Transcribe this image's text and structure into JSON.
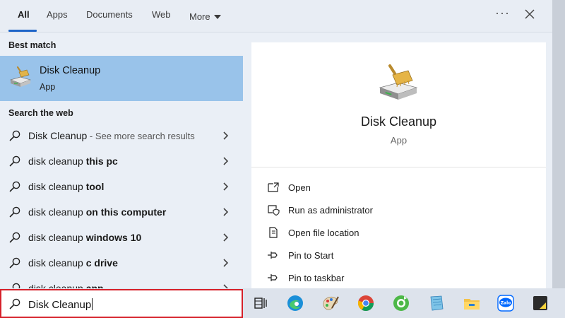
{
  "tabs": [
    {
      "label": "All",
      "active": true
    },
    {
      "label": "Apps"
    },
    {
      "label": "Documents"
    },
    {
      "label": "Web"
    },
    {
      "label": "More"
    }
  ],
  "top_icons": {
    "more_options": "more-options-icon",
    "close": "close-icon"
  },
  "left": {
    "best_match_title": "Best match",
    "best_match": {
      "name": "Disk Cleanup",
      "type": "App",
      "icon": "disk-cleanup-icon"
    },
    "web_section_title": "Search the web",
    "web_results": [
      {
        "prefix": "Disk Cleanup",
        "bold": "",
        "suffix": " - See more search results"
      },
      {
        "prefix": "disk cleanup ",
        "bold": "this pc",
        "suffix": ""
      },
      {
        "prefix": "disk cleanup ",
        "bold": "tool",
        "suffix": ""
      },
      {
        "prefix": "disk cleanup ",
        "bold": "on this computer",
        "suffix": ""
      },
      {
        "prefix": "disk cleanup ",
        "bold": "windows 10",
        "suffix": ""
      },
      {
        "prefix": "disk cleanup ",
        "bold": "c drive",
        "suffix": ""
      },
      {
        "prefix": "disk cleanup ",
        "bold": "app",
        "suffix": ""
      }
    ]
  },
  "right": {
    "app_name": "Disk Cleanup",
    "app_type": "App",
    "actions": [
      {
        "label": "Open",
        "icon": "open-icon"
      },
      {
        "label": "Run as administrator",
        "icon": "shield-icon"
      },
      {
        "label": "Open file location",
        "icon": "file-location-icon"
      },
      {
        "label": "Pin to Start",
        "icon": "pin-icon"
      },
      {
        "label": "Pin to taskbar",
        "icon": "pin-icon"
      }
    ]
  },
  "search": {
    "value": "Disk Cleanup"
  },
  "taskbar_icons": [
    "task-view-icon",
    "edge-icon",
    "paint-icon",
    "chrome-icon",
    "coccoc-icon",
    "notepad-icon",
    "file-explorer-icon",
    "zalo-icon",
    "sticky-notes-icon"
  ],
  "colors": {
    "accent": "#1f66c9",
    "selection": "#99c3ea",
    "search_border": "#d6212a"
  }
}
